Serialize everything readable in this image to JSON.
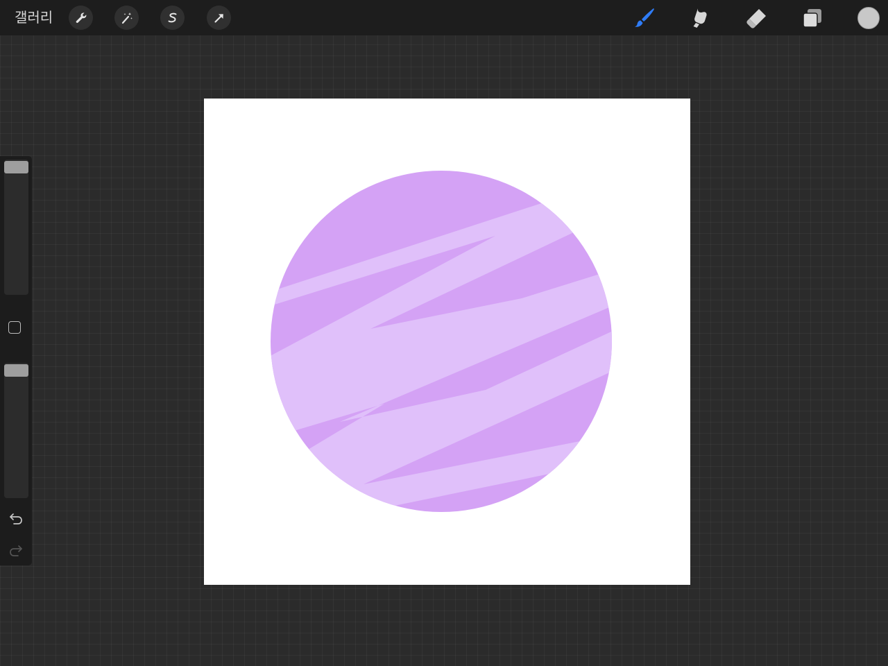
{
  "topbar": {
    "gallery_label": "갤러리",
    "left_tools": [
      "wrench-icon",
      "magic-wand-icon",
      "selection-s-icon",
      "transform-arrow-icon"
    ],
    "right_tools": [
      "brush-icon",
      "smudge-icon",
      "eraser-icon",
      "layers-icon"
    ],
    "active_tool": "brush",
    "active_color": "#2f7cf6",
    "current_color": "#c8c8c8"
  },
  "canvas": {
    "background": "#ffffff",
    "planet_color": "#d4a2f5",
    "stripe_color": "#e0c0fa"
  },
  "sidebar": {
    "brush_size_level": 1.0,
    "opacity_level": 1.0
  }
}
